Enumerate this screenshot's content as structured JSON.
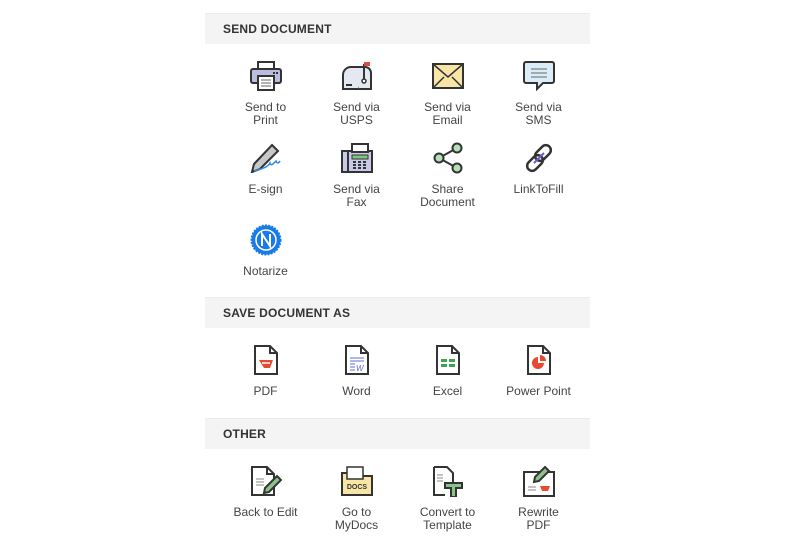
{
  "sections": [
    {
      "title": "SEND DOCUMENT",
      "items": [
        {
          "label": "Send to\nPrint",
          "icon": "printer-icon"
        },
        {
          "label": "Send via\nUSPS",
          "icon": "mailbox-icon"
        },
        {
          "label": "Send via\nEmail",
          "icon": "envelope-icon"
        },
        {
          "label": "Send via\nSMS",
          "icon": "chat-bubble-icon"
        },
        {
          "label": "E-sign",
          "icon": "pen-signature-icon"
        },
        {
          "label": "Send via\nFax",
          "icon": "fax-icon"
        },
        {
          "label": "Share\nDocument",
          "icon": "share-icon"
        },
        {
          "label": "LinkToFill",
          "icon": "link-icon"
        },
        {
          "label": "Notarize",
          "icon": "notary-badge-icon"
        }
      ]
    },
    {
      "title": "SAVE DOCUMENT AS",
      "items": [
        {
          "label": "PDF",
          "icon": "pdf-file-icon"
        },
        {
          "label": "Word",
          "icon": "word-file-icon"
        },
        {
          "label": "Excel",
          "icon": "excel-file-icon"
        },
        {
          "label": "Power Point",
          "icon": "powerpoint-file-icon"
        }
      ]
    },
    {
      "title": "OTHER",
      "items": [
        {
          "label": "Back to Edit",
          "icon": "edit-document-icon"
        },
        {
          "label": "Go to\nMyDocs",
          "icon": "docs-folder-icon",
          "badge": "DOCS"
        },
        {
          "label": "Convert to\nTemplate",
          "icon": "template-icon"
        },
        {
          "label": "Rewrite\nPDF",
          "icon": "rewrite-pdf-icon"
        }
      ]
    }
  ]
}
